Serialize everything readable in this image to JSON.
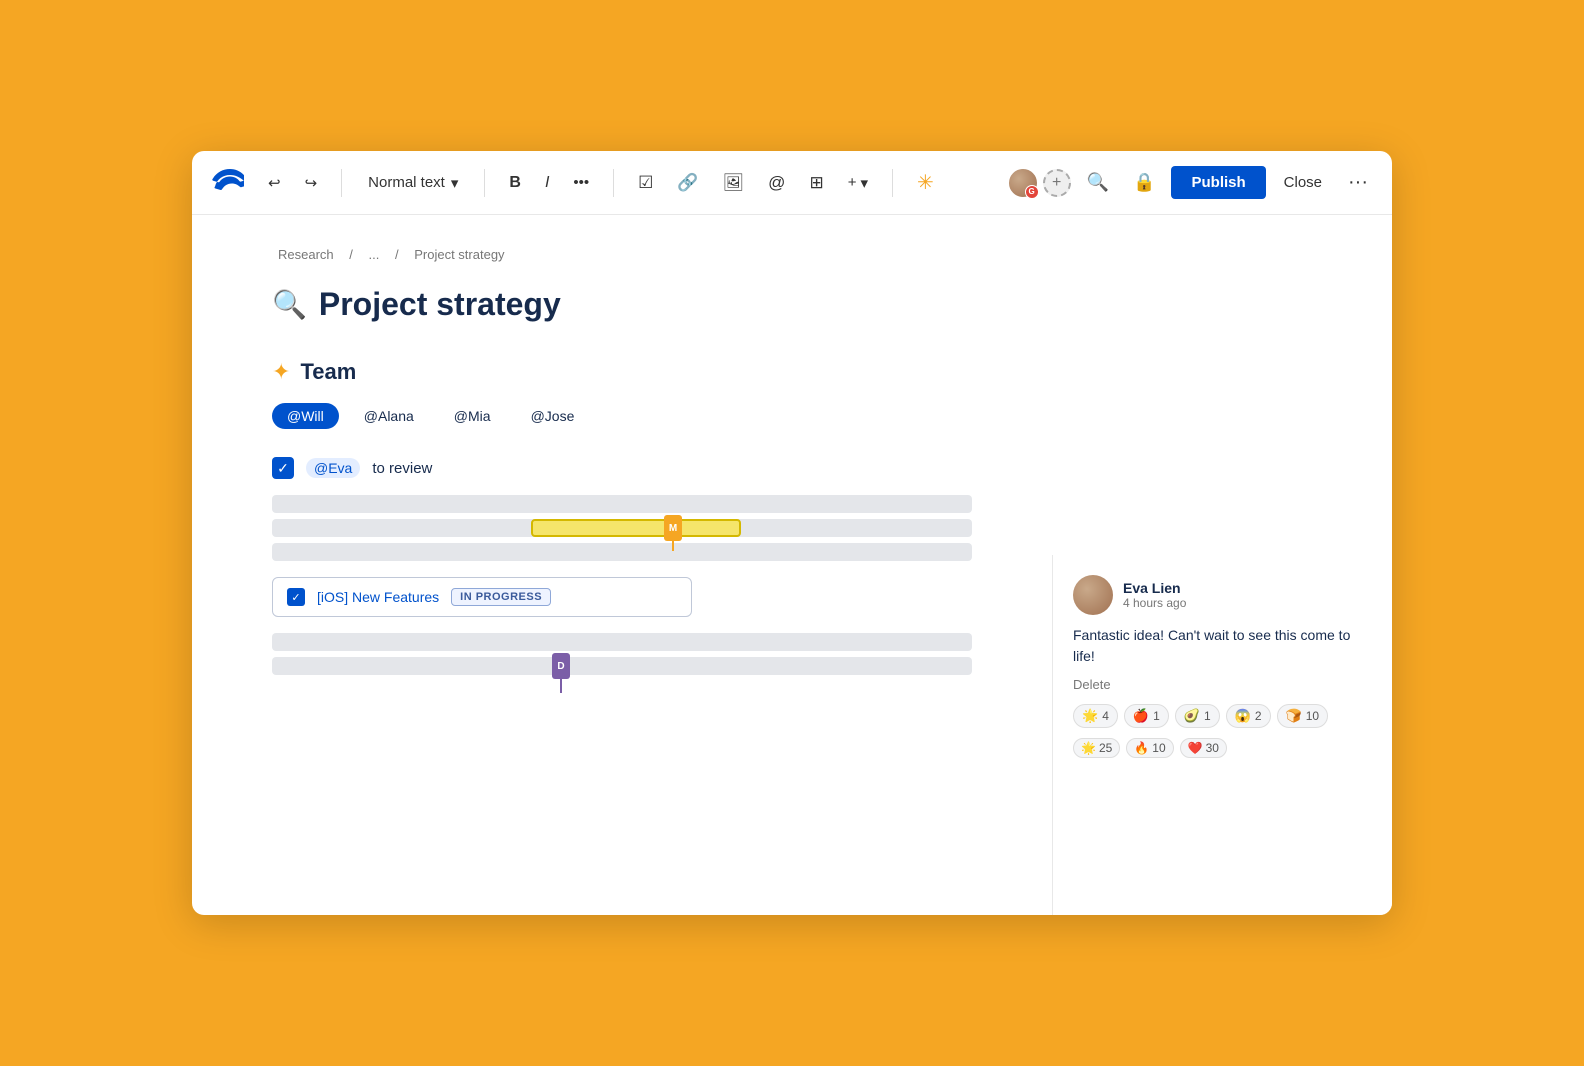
{
  "app": {
    "logo_label": "Confluence logo"
  },
  "toolbar": {
    "undo_label": "↩",
    "redo_label": "↪",
    "text_style_label": "Normal text",
    "chevron": "▾",
    "bold_label": "B",
    "italic_label": "I",
    "more_format_label": "•••",
    "checklist_label": "☑",
    "link_label": "🔗",
    "image_label": "🖼",
    "mention_label": "@",
    "table_label": "⊞",
    "insert_label": "+▾",
    "ai_label": "✳",
    "search_label": "🔍",
    "lock_label": "🔒",
    "publish_label": "Publish",
    "close_label": "Close",
    "more_label": "···"
  },
  "breadcrumb": {
    "items": [
      "Research",
      "...",
      "Project strategy"
    ]
  },
  "page": {
    "title_icon": "🔍",
    "title": "Project strategy"
  },
  "team_section": {
    "heading_icon": "✦",
    "heading": "Team",
    "members": [
      {
        "label": "@Will",
        "style": "blue"
      },
      {
        "label": "@Alana",
        "style": "outline"
      },
      {
        "label": "@Mia",
        "style": "outline"
      },
      {
        "label": "@Jose",
        "style": "outline"
      }
    ]
  },
  "task1": {
    "mention": "@Eva",
    "text": "to review"
  },
  "gantt1": {
    "rows": [
      {
        "width": "100%",
        "left": "0%",
        "color": "#E4E6EA"
      },
      {
        "left": "37%",
        "width": "30%",
        "color": "#F5E56B",
        "cursor": "M",
        "cursor_left": "56%"
      },
      {
        "width": "100%",
        "left": "0%",
        "color": "#E4E6EA"
      }
    ]
  },
  "task2": {
    "text": "[iOS] New Features",
    "badge": "IN PROGRESS"
  },
  "gantt2": {
    "rows": [
      {
        "width": "100%",
        "color": "#E4E6EA"
      },
      {
        "width": "100%",
        "color": "#E4E6EA",
        "cursor": "D",
        "cursor_left": "40%"
      }
    ]
  },
  "comment": {
    "author_name": "Eva Lien",
    "author_time": "4 hours ago",
    "text": "Fantastic idea! Can't wait to see this come to life!",
    "delete_label": "Delete",
    "reactions": [
      {
        "emoji": "🌟",
        "count": "4"
      },
      {
        "emoji": "🍎",
        "count": "1"
      },
      {
        "emoji": "🥑",
        "count": "1"
      },
      {
        "emoji": "😱",
        "count": "2"
      },
      {
        "emoji": "🍞",
        "count": "10"
      }
    ],
    "bottom_reactions": [
      {
        "emoji": "🌟",
        "count": "25"
      },
      {
        "emoji": "🔥",
        "count": "10"
      },
      {
        "emoji": "❤️",
        "count": "30"
      }
    ]
  }
}
